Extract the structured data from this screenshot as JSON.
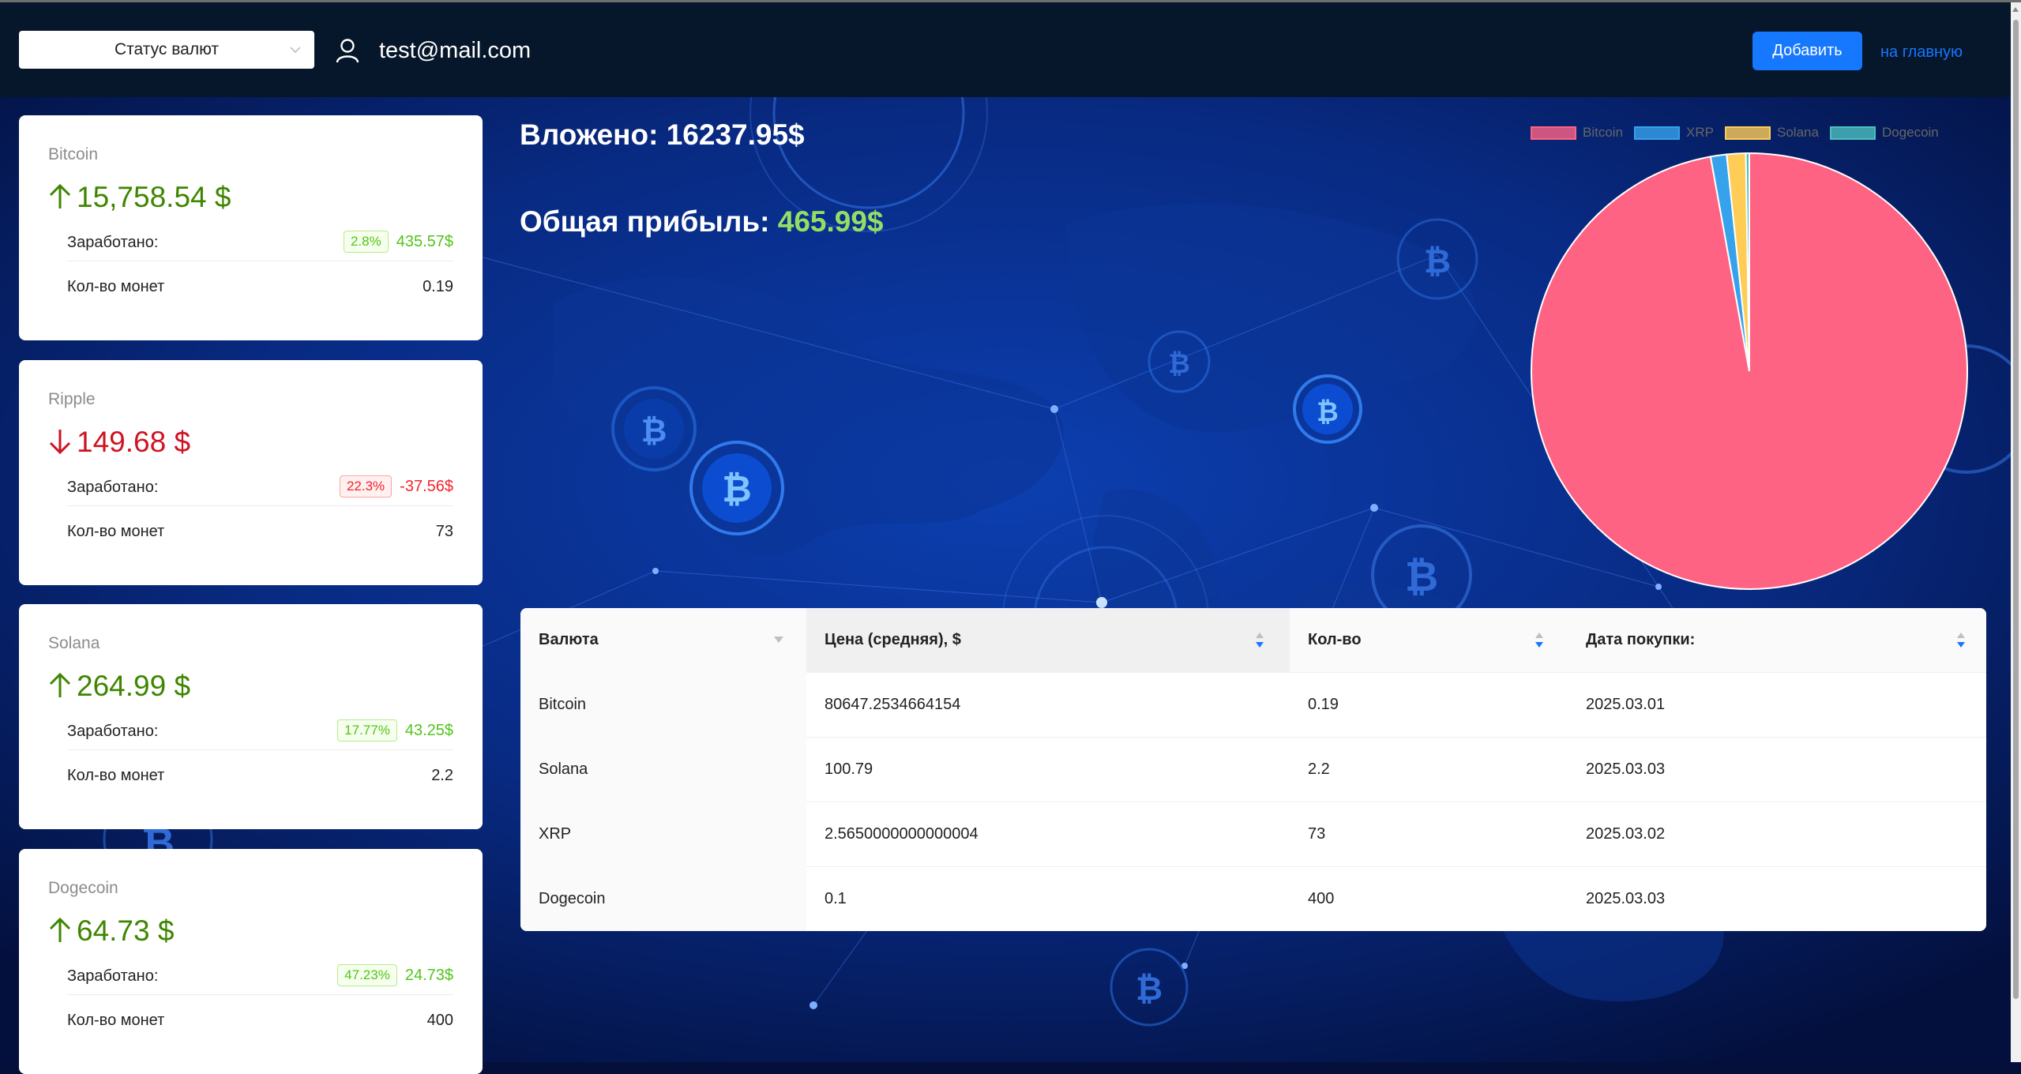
{
  "header": {
    "select_label": "Статус валют",
    "email": "test@mail.com",
    "add_button": "Добавить",
    "home_link": "на главную"
  },
  "cards": [
    {
      "name": "Bitcoin",
      "price": "15,758.54 $",
      "trend": "up",
      "earned_label": "Заработано:",
      "percent": "2.8%",
      "amount": "435.57$",
      "sign": "pos",
      "coins_label": "Кол-во монет",
      "coins": "0.19"
    },
    {
      "name": "Ripple",
      "price": "149.68 $",
      "trend": "down",
      "earned_label": "Заработано:",
      "percent": "22.3%",
      "amount": "-37.56$",
      "sign": "neg",
      "coins_label": "Кол-во монет",
      "coins": "73"
    },
    {
      "name": "Solana",
      "price": "264.99 $",
      "trend": "up",
      "earned_label": "Заработано:",
      "percent": "17.77%",
      "amount": "43.25$",
      "sign": "pos",
      "coins_label": "Кол-во монет",
      "coins": "2.2"
    },
    {
      "name": "Dogecoin",
      "price": "64.73 $",
      "trend": "up",
      "earned_label": "Заработано:",
      "percent": "47.23%",
      "amount": "24.73$",
      "sign": "pos",
      "coins_label": "Кол-во монет",
      "coins": "400"
    }
  ],
  "summary": {
    "invested_label": "Вложено:",
    "invested_value": "16237.95$",
    "profit_label": "Общая прибыль:",
    "profit_value": "465.99$"
  },
  "chart_data": {
    "type": "pie",
    "labels": [
      "Bitcoin",
      "XRP",
      "Solana",
      "Dogecoin"
    ],
    "values": [
      15323.0,
      187.2,
      221.7,
      40.0
    ],
    "colors": [
      "#ff6384",
      "#36a2eb",
      "#ffcd56",
      "#4bc0c0"
    ],
    "legend_position": "top"
  },
  "table": {
    "columns": [
      "Валюта",
      "Цена (средняя), $",
      "Кол-во",
      "Дата покупки:"
    ],
    "rows": [
      [
        "Bitcoin",
        "80647.2534664154",
        "0.19",
        "2025.03.01"
      ],
      [
        "Solana",
        "100.79",
        "2.2",
        "2025.03.03"
      ],
      [
        "XRP",
        "2.5650000000000004",
        "73",
        "2025.03.02"
      ],
      [
        "Dogecoin",
        "0.1",
        "400",
        "2025.03.03"
      ]
    ]
  }
}
